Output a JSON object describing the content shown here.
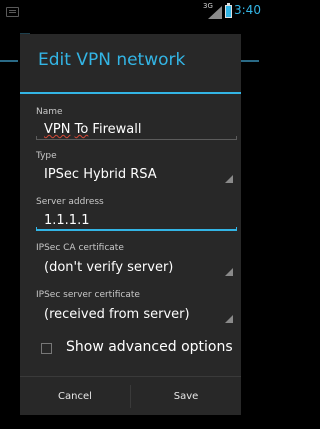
{
  "status_bar": {
    "notification_icon": "notification-icon",
    "network_type": "3G",
    "time": "3:40",
    "accent_color": "#33b5e5"
  },
  "dialog": {
    "title": "Edit VPN network",
    "title_color": "#33b5e5",
    "fields": {
      "name": {
        "label": "Name",
        "value_first": "VPN",
        "value_second": "To",
        "value_rest": " Firewall"
      },
      "type": {
        "label": "Type",
        "value": "IPSec Hybrid RSA"
      },
      "server_address": {
        "label": "Server address",
        "value": "1.1.1.1"
      },
      "ca_certificate": {
        "label": "IPSec CA certificate",
        "value": "(don't verify server)"
      },
      "server_certificate": {
        "label": "IPSec server certificate",
        "value": "(received from server)"
      }
    },
    "show_advanced_options": {
      "label": "Show advanced options",
      "checked": false
    },
    "buttons": {
      "cancel": "Cancel",
      "save": "Save"
    }
  }
}
